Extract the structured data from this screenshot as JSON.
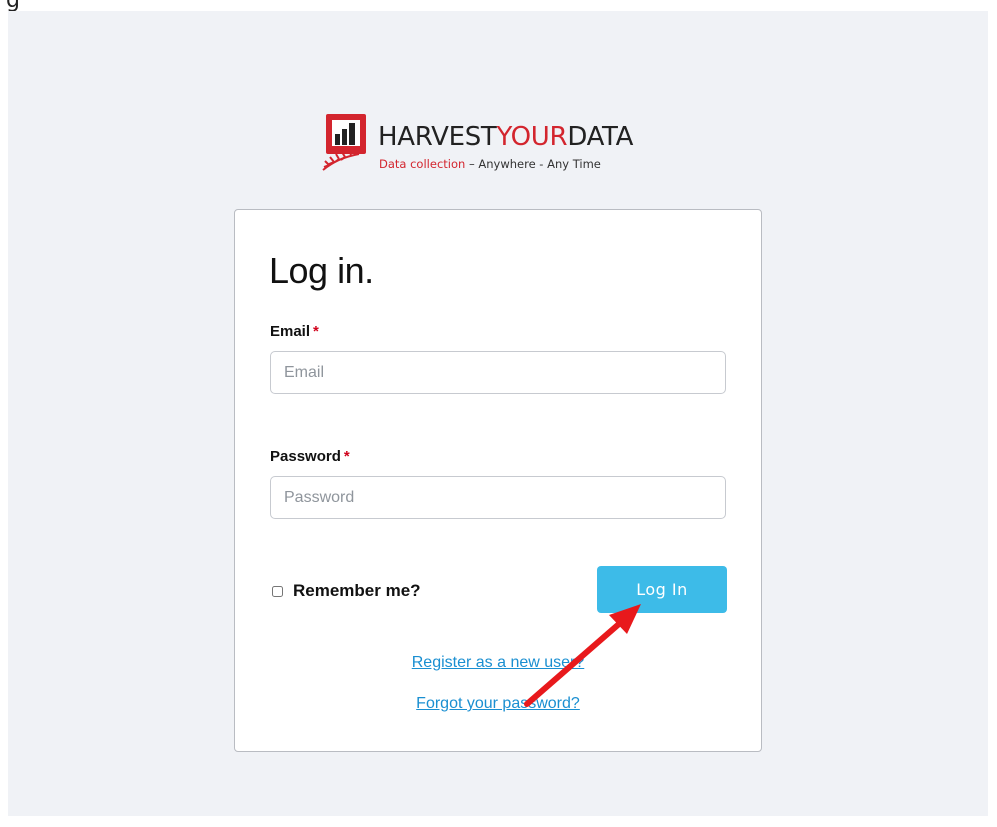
{
  "top_fragment": "g",
  "brand": {
    "name_part1": "HARVEST",
    "name_part2": "YOUR",
    "name_part3": "DATA",
    "tagline_part1": "Data collection",
    "tagline_part2": " – Anywhere - Any Time",
    "icon": "bar-chart-wheat-logo",
    "accent_color": "#d3252e"
  },
  "form": {
    "title": "Log in.",
    "email_label": "Email",
    "email_placeholder": "Email",
    "email_value": "",
    "password_label": "Password",
    "password_placeholder": "Password",
    "password_value": "",
    "required_marker": "*",
    "remember_label": "Remember me?",
    "remember_checked": false,
    "submit_label": "Log In",
    "register_link": "Register as a new user?",
    "forgot_link": "Forgot your password?",
    "button_color": "#3dbbe8",
    "link_color": "#1a8fd1"
  },
  "annotation": {
    "icon": "red-arrow-annotation",
    "color": "#e8191c"
  }
}
